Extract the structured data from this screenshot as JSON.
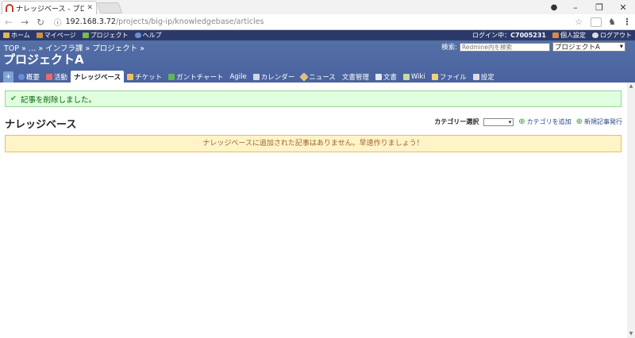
{
  "browser": {
    "tab_title": "ナレッジベース - プロジェクトA",
    "url_host": "192.168.3.72",
    "url_path": "/projects/big-ip/knowledgebase/articles"
  },
  "top_menu": {
    "home": "ホーム",
    "my_page": "マイページ",
    "projects": "プロジェクト",
    "help": "ヘルプ",
    "logged_in_label": "ログイン中：",
    "login_user": "C7005231",
    "my_account": "個人設定",
    "logout": "ログアウト"
  },
  "header": {
    "breadcrumb": "TOP » … » インフラ課 »  プロジェクト »",
    "project_title": "プロジェクトA",
    "search_label": "検索:",
    "search_placeholder": "Redmine内を検索",
    "project_jump": "プロジェクトA"
  },
  "main_menu": {
    "new": "+",
    "items": [
      "概要",
      "活動",
      "ナレッジベース",
      "チケット",
      "ガントチャート",
      "Agile",
      "カレンダー",
      "ニュース",
      "文書管理",
      "文書",
      "Wiki",
      "ファイル",
      "設定"
    ]
  },
  "content": {
    "flash": "記事を削除しました。",
    "title": "ナレッジベース",
    "category_label": "カテゴリー選択",
    "add_category": "カテゴリを追加",
    "new_article": "新規記事発行",
    "warning": "ナレッジベースに追加された記事はありません。早速作りましょう！"
  }
}
